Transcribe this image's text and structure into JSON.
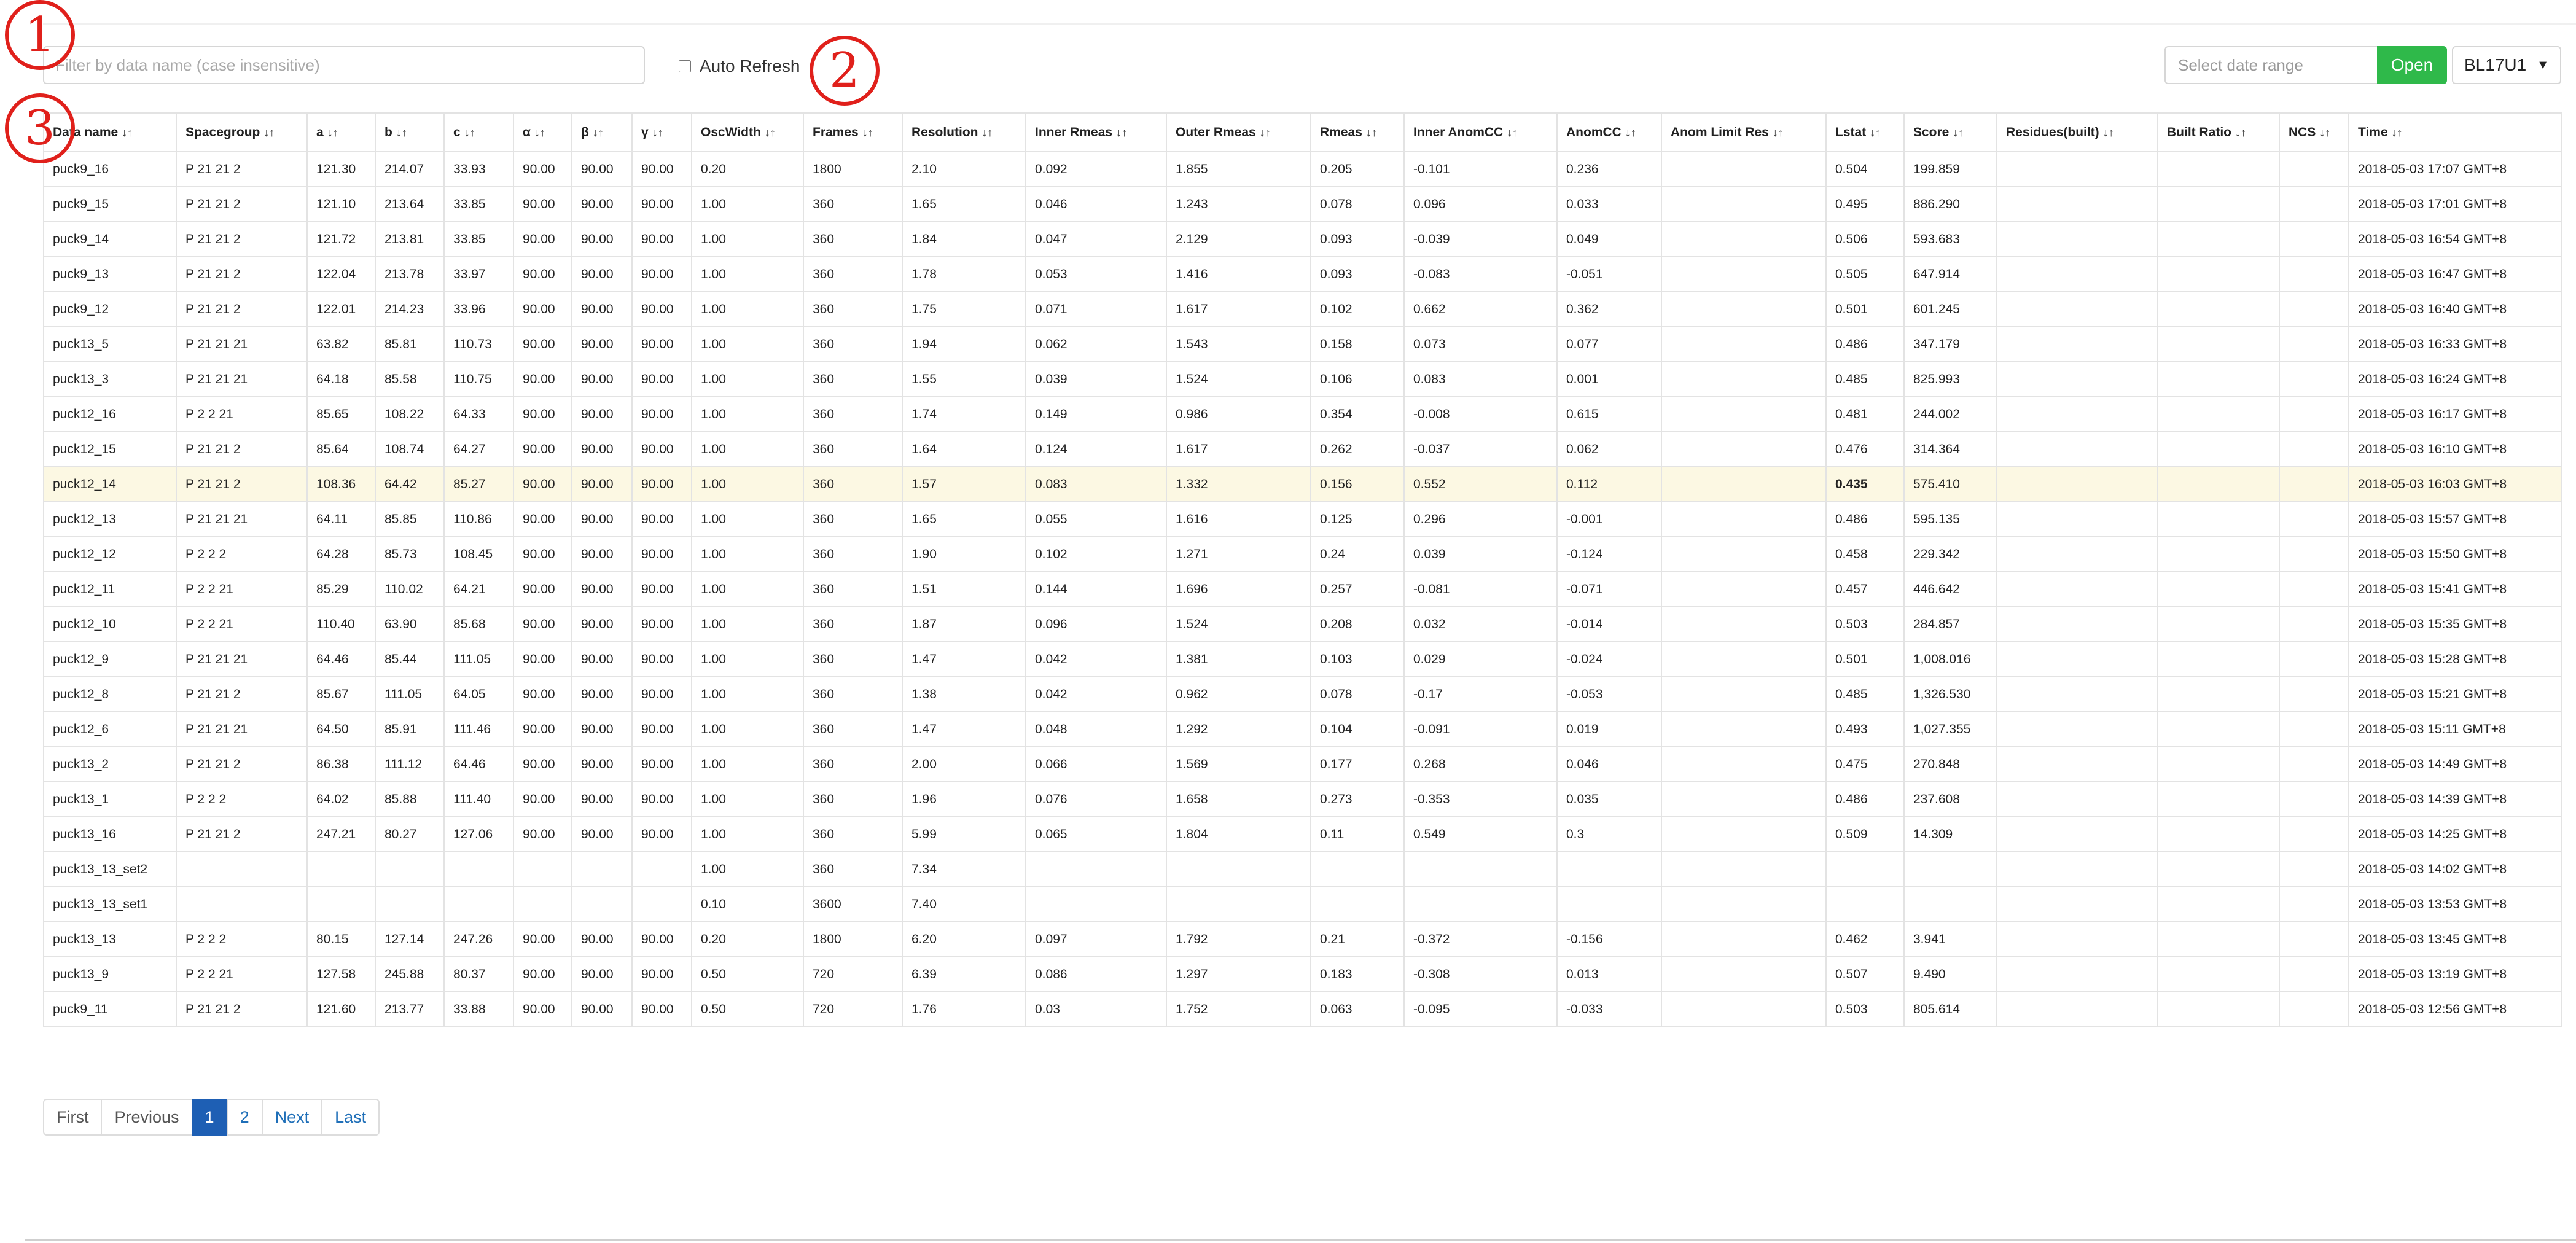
{
  "filter": {
    "placeholder": "Filter by data name (case insensitive)"
  },
  "auto_refresh": {
    "label": "Auto Refresh",
    "checked": false
  },
  "date_range": {
    "placeholder": "Select date range"
  },
  "open_button": {
    "label": "Open"
  },
  "beamline": {
    "selected": "BL17U1"
  },
  "markers": [
    "1",
    "2",
    "3"
  ],
  "colors": {
    "open_button": "#2fb94a",
    "active_page": "#1e5fb4",
    "highlight_row": "#fcf8e3",
    "marker": "#e0201b"
  },
  "table": {
    "sort_icon": "↓↑",
    "columns": [
      "Data name",
      "Spacegroup",
      "a",
      "b",
      "c",
      "α",
      "β",
      "γ",
      "OscWidth",
      "Frames",
      "Resolution",
      "Inner Rmeas",
      "Outer Rmeas",
      "Rmeas",
      "Inner AnomCC",
      "AnomCC",
      "Anom Limit Res",
      "Lstat",
      "Score",
      "Residues(built)",
      "Built Ratio",
      "NCS",
      "Time"
    ],
    "highlight_row": 9,
    "rows": [
      [
        "puck9_16",
        "P 21 21 2",
        "121.30",
        "214.07",
        "33.93",
        "90.00",
        "90.00",
        "90.00",
        "0.20",
        "1800",
        "2.10",
        "0.092",
        "1.855",
        "0.205",
        "-0.101",
        "0.236",
        "",
        "0.504",
        "199.859",
        "",
        "",
        "",
        "2018-05-03 17:07 GMT+8"
      ],
      [
        "puck9_15",
        "P 21 21 2",
        "121.10",
        "213.64",
        "33.85",
        "90.00",
        "90.00",
        "90.00",
        "1.00",
        "360",
        "1.65",
        "0.046",
        "1.243",
        "0.078",
        "0.096",
        "0.033",
        "",
        "0.495",
        "886.290",
        "",
        "",
        "",
        "2018-05-03 17:01 GMT+8"
      ],
      [
        "puck9_14",
        "P 21 21 2",
        "121.72",
        "213.81",
        "33.85",
        "90.00",
        "90.00",
        "90.00",
        "1.00",
        "360",
        "1.84",
        "0.047",
        "2.129",
        "0.093",
        "-0.039",
        "0.049",
        "",
        "0.506",
        "593.683",
        "",
        "",
        "",
        "2018-05-03 16:54 GMT+8"
      ],
      [
        "puck9_13",
        "P 21 21 2",
        "122.04",
        "213.78",
        "33.97",
        "90.00",
        "90.00",
        "90.00",
        "1.00",
        "360",
        "1.78",
        "0.053",
        "1.416",
        "0.093",
        "-0.083",
        "-0.051",
        "",
        "0.505",
        "647.914",
        "",
        "",
        "",
        "2018-05-03 16:47 GMT+8"
      ],
      [
        "puck9_12",
        "P 21 21 2",
        "122.01",
        "214.23",
        "33.96",
        "90.00",
        "90.00",
        "90.00",
        "1.00",
        "360",
        "1.75",
        "0.071",
        "1.617",
        "0.102",
        "0.662",
        "0.362",
        "",
        "0.501",
        "601.245",
        "",
        "",
        "",
        "2018-05-03 16:40 GMT+8"
      ],
      [
        "puck13_5",
        "P 21 21 21",
        "63.82",
        "85.81",
        "110.73",
        "90.00",
        "90.00",
        "90.00",
        "1.00",
        "360",
        "1.94",
        "0.062",
        "1.543",
        "0.158",
        "0.073",
        "0.077",
        "",
        "0.486",
        "347.179",
        "",
        "",
        "",
        "2018-05-03 16:33 GMT+8"
      ],
      [
        "puck13_3",
        "P 21 21 21",
        "64.18",
        "85.58",
        "110.75",
        "90.00",
        "90.00",
        "90.00",
        "1.00",
        "360",
        "1.55",
        "0.039",
        "1.524",
        "0.106",
        "0.083",
        "0.001",
        "",
        "0.485",
        "825.993",
        "",
        "",
        "",
        "2018-05-03 16:24 GMT+8"
      ],
      [
        "puck12_16",
        "P 2 2 21",
        "85.65",
        "108.22",
        "64.33",
        "90.00",
        "90.00",
        "90.00",
        "1.00",
        "360",
        "1.74",
        "0.149",
        "0.986",
        "0.354",
        "-0.008",
        "0.615",
        "",
        "0.481",
        "244.002",
        "",
        "",
        "",
        "2018-05-03 16:17 GMT+8"
      ],
      [
        "puck12_15",
        "P 21 21 2",
        "85.64",
        "108.74",
        "64.27",
        "90.00",
        "90.00",
        "90.00",
        "1.00",
        "360",
        "1.64",
        "0.124",
        "1.617",
        "0.262",
        "-0.037",
        "0.062",
        "",
        "0.476",
        "314.364",
        "",
        "",
        "",
        "2018-05-03 16:10 GMT+8"
      ],
      [
        "puck12_14",
        "P 21 21 2",
        "108.36",
        "64.42",
        "85.27",
        "90.00",
        "90.00",
        "90.00",
        "1.00",
        "360",
        "1.57",
        "0.083",
        "1.332",
        "0.156",
        "0.552",
        "0.112",
        "",
        "0.435",
        "575.410",
        "",
        "",
        "",
        "2018-05-03 16:03 GMT+8"
      ],
      [
        "puck12_13",
        "P 21 21 21",
        "64.11",
        "85.85",
        "110.86",
        "90.00",
        "90.00",
        "90.00",
        "1.00",
        "360",
        "1.65",
        "0.055",
        "1.616",
        "0.125",
        "0.296",
        "-0.001",
        "",
        "0.486",
        "595.135",
        "",
        "",
        "",
        "2018-05-03 15:57 GMT+8"
      ],
      [
        "puck12_12",
        "P 2 2 2",
        "64.28",
        "85.73",
        "108.45",
        "90.00",
        "90.00",
        "90.00",
        "1.00",
        "360",
        "1.90",
        "0.102",
        "1.271",
        "0.24",
        "0.039",
        "-0.124",
        "",
        "0.458",
        "229.342",
        "",
        "",
        "",
        "2018-05-03 15:50 GMT+8"
      ],
      [
        "puck12_11",
        "P 2 2 21",
        "85.29",
        "110.02",
        "64.21",
        "90.00",
        "90.00",
        "90.00",
        "1.00",
        "360",
        "1.51",
        "0.144",
        "1.696",
        "0.257",
        "-0.081",
        "-0.071",
        "",
        "0.457",
        "446.642",
        "",
        "",
        "",
        "2018-05-03 15:41 GMT+8"
      ],
      [
        "puck12_10",
        "P 2 2 21",
        "110.40",
        "63.90",
        "85.68",
        "90.00",
        "90.00",
        "90.00",
        "1.00",
        "360",
        "1.87",
        "0.096",
        "1.524",
        "0.208",
        "0.032",
        "-0.014",
        "",
        "0.503",
        "284.857",
        "",
        "",
        "",
        "2018-05-03 15:35 GMT+8"
      ],
      [
        "puck12_9",
        "P 21 21 21",
        "64.46",
        "85.44",
        "111.05",
        "90.00",
        "90.00",
        "90.00",
        "1.00",
        "360",
        "1.47",
        "0.042",
        "1.381",
        "0.103",
        "0.029",
        "-0.024",
        "",
        "0.501",
        "1,008.016",
        "",
        "",
        "",
        "2018-05-03 15:28 GMT+8"
      ],
      [
        "puck12_8",
        "P 21 21 2",
        "85.67",
        "111.05",
        "64.05",
        "90.00",
        "90.00",
        "90.00",
        "1.00",
        "360",
        "1.38",
        "0.042",
        "0.962",
        "0.078",
        "-0.17",
        "-0.053",
        "",
        "0.485",
        "1,326.530",
        "",
        "",
        "",
        "2018-05-03 15:21 GMT+8"
      ],
      [
        "puck12_6",
        "P 21 21 21",
        "64.50",
        "85.91",
        "111.46",
        "90.00",
        "90.00",
        "90.00",
        "1.00",
        "360",
        "1.47",
        "0.048",
        "1.292",
        "0.104",
        "-0.091",
        "0.019",
        "",
        "0.493",
        "1,027.355",
        "",
        "",
        "",
        "2018-05-03 15:11 GMT+8"
      ],
      [
        "puck13_2",
        "P 21 21 2",
        "86.38",
        "111.12",
        "64.46",
        "90.00",
        "90.00",
        "90.00",
        "1.00",
        "360",
        "2.00",
        "0.066",
        "1.569",
        "0.177",
        "0.268",
        "0.046",
        "",
        "0.475",
        "270.848",
        "",
        "",
        "",
        "2018-05-03 14:49 GMT+8"
      ],
      [
        "puck13_1",
        "P 2 2 2",
        "64.02",
        "85.88",
        "111.40",
        "90.00",
        "90.00",
        "90.00",
        "1.00",
        "360",
        "1.96",
        "0.076",
        "1.658",
        "0.273",
        "-0.353",
        "0.035",
        "",
        "0.486",
        "237.608",
        "",
        "",
        "",
        "2018-05-03 14:39 GMT+8"
      ],
      [
        "puck13_16",
        "P 21 21 2",
        "247.21",
        "80.27",
        "127.06",
        "90.00",
        "90.00",
        "90.00",
        "1.00",
        "360",
        "5.99",
        "0.065",
        "1.804",
        "0.11",
        "0.549",
        "0.3",
        "",
        "0.509",
        "14.309",
        "",
        "",
        "",
        "2018-05-03 14:25 GMT+8"
      ],
      [
        "puck13_13_set2",
        "",
        "",
        "",
        "",
        "",
        "",
        "",
        "1.00",
        "360",
        "7.34",
        "",
        "",
        "",
        "",
        "",
        "",
        "",
        "",
        "",
        "",
        "",
        "2018-05-03 14:02 GMT+8"
      ],
      [
        "puck13_13_set1",
        "",
        "",
        "",
        "",
        "",
        "",
        "",
        "0.10",
        "3600",
        "7.40",
        "",
        "",
        "",
        "",
        "",
        "",
        "",
        "",
        "",
        "",
        "",
        "2018-05-03 13:53 GMT+8"
      ],
      [
        "puck13_13",
        "P 2 2 2",
        "80.15",
        "127.14",
        "247.26",
        "90.00",
        "90.00",
        "90.00",
        "0.20",
        "1800",
        "6.20",
        "0.097",
        "1.792",
        "0.21",
        "-0.372",
        "-0.156",
        "",
        "0.462",
        "3.941",
        "",
        "",
        "",
        "2018-05-03 13:45 GMT+8"
      ],
      [
        "puck13_9",
        "P 2 2 21",
        "127.58",
        "245.88",
        "80.37",
        "90.00",
        "90.00",
        "90.00",
        "0.50",
        "720",
        "6.39",
        "0.086",
        "1.297",
        "0.183",
        "-0.308",
        "0.013",
        "",
        "0.507",
        "9.490",
        "",
        "",
        "",
        "2018-05-03 13:19 GMT+8"
      ],
      [
        "puck9_11",
        "P 21 21 2",
        "121.60",
        "213.77",
        "33.88",
        "90.00",
        "90.00",
        "90.00",
        "0.50",
        "720",
        "1.76",
        "0.03",
        "1.752",
        "0.063",
        "-0.095",
        "-0.033",
        "",
        "0.503",
        "805.614",
        "",
        "",
        "",
        "2018-05-03 12:56 GMT+8"
      ]
    ]
  },
  "pagination": {
    "items": [
      {
        "label": "First",
        "type": "plain"
      },
      {
        "label": "Previous",
        "type": "plain"
      },
      {
        "label": "1",
        "type": "active"
      },
      {
        "label": "2",
        "type": "link"
      },
      {
        "label": "Next",
        "type": "link"
      },
      {
        "label": "Last",
        "type": "link"
      }
    ]
  }
}
